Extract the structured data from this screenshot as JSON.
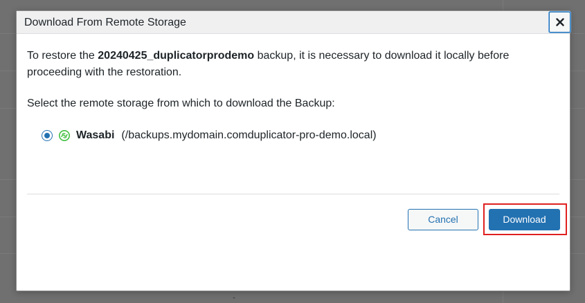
{
  "dialog": {
    "title": "Download From Remote Storage",
    "close_icon": "close-icon"
  },
  "intro": {
    "prefix": "To restore the ",
    "backup_name": "20240425_duplicatorprodemo",
    "suffix": " backup, it is necessary to download it locally before proceeding with the restoration."
  },
  "select_prompt": "Select the remote storage from which to download the Backup:",
  "storage_options": [
    {
      "name": "Wasabi",
      "path": "(/backups.mydomain.comduplicator-pro-demo.local)",
      "selected": true,
      "icon": "wasabi-icon"
    }
  ],
  "buttons": {
    "cancel_label": "Cancel",
    "download_label": "Download"
  },
  "colors": {
    "accent": "#2271b1",
    "highlight": "#e02020",
    "wasabi_green": "#3fbf3f"
  }
}
